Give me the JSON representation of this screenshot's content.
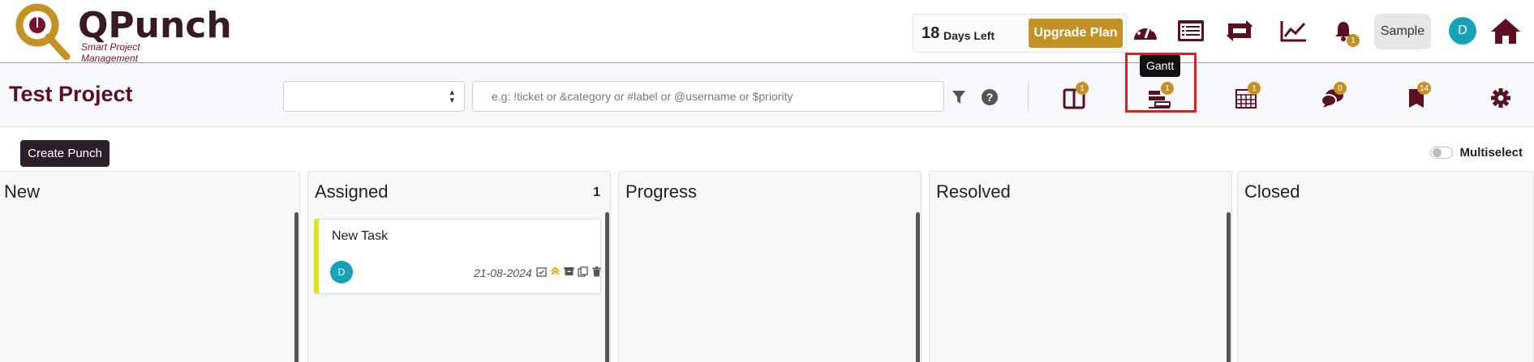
{
  "header": {
    "logo_text": "QPunch",
    "logo_subtitle": "Smart Project Management",
    "trial_days": "18",
    "trial_label": "Days Left",
    "upgrade_label": "Upgrade Plan",
    "notification_count": "1",
    "user_button": "Sample",
    "user_initial": "D",
    "icons": [
      "dashboard-icon",
      "list-icon",
      "sync-icon",
      "chart-line-icon",
      "bell-icon",
      "home-icon"
    ]
  },
  "project": {
    "title": "Test Project",
    "search_placeholder": "e.g: !ticket or &category or #label or @username or $priority",
    "select_value": "",
    "view_icons": [
      {
        "name": "board-icon",
        "badge": "1"
      },
      {
        "name": "gantt-icon",
        "badge": "1"
      },
      {
        "name": "calendar-icon",
        "badge": "1"
      },
      {
        "name": "chat-icon",
        "badge": "0"
      },
      {
        "name": "book-icon",
        "badge": "14"
      }
    ],
    "tooltip": "Gantt"
  },
  "board": {
    "create_label": "Create Punch",
    "multiselect_label": "Multiselect",
    "columns": [
      {
        "title": "New",
        "count": ""
      },
      {
        "title": "Assigned",
        "count": "1"
      },
      {
        "title": "Progress",
        "count": ""
      },
      {
        "title": "Resolved",
        "count": ""
      },
      {
        "title": "Closed",
        "count": ""
      }
    ],
    "card": {
      "title": "New Task",
      "assignee_initial": "D",
      "date": "21-08-2024",
      "accent_color": "#e3e31a"
    }
  },
  "colors": {
    "brand_gold": "#c49224",
    "brand_maroon": "#5a1020",
    "avatar_teal": "#17a2b8",
    "highlight_red": "#e02020"
  }
}
